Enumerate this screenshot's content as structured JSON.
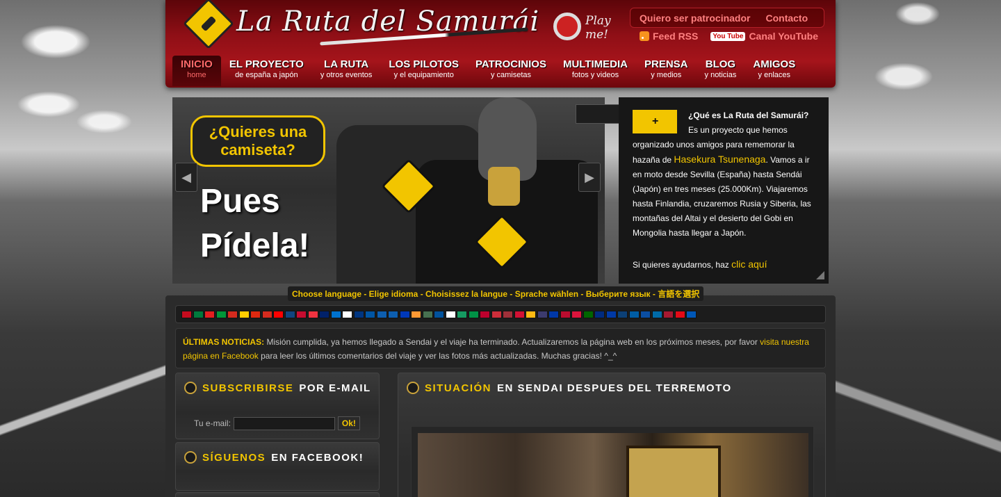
{
  "header": {
    "logo_text": "La Ruta del Samurái",
    "play_me": "Play me!",
    "top_links": [
      "Quiero ser patrocinador",
      "Contacto"
    ],
    "feed_rss": "Feed RSS",
    "youtube_badge": "You Tube",
    "canal_youtube": "Canal YouTube",
    "colors": {
      "header_red": "#8f0f16",
      "link_pink": "#ff8080",
      "accent_yellow": "#f2c500"
    }
  },
  "nav": [
    {
      "title": "INICIO",
      "sub": "home",
      "active": true
    },
    {
      "title": "EL PROYECTO",
      "sub": "de españa a japón"
    },
    {
      "title": "LA RUTA",
      "sub": "y otros eventos"
    },
    {
      "title": "LOS PILOTOS",
      "sub": "y el equipamiento"
    },
    {
      "title": "PATROCINIOS",
      "sub": "y camisetas"
    },
    {
      "title": "MULTIMEDIA",
      "sub": "fotos y videos"
    },
    {
      "title": "PRENSA",
      "sub": "y medios"
    },
    {
      "title": "BLOG",
      "sub": "y noticias"
    },
    {
      "title": "AMIGOS",
      "sub": "y enlaces"
    }
  ],
  "slider": {
    "bubble": "¿Quieres una camiseta?",
    "headline": "Pues Pídela!",
    "prev_icon": "chevron-left-icon",
    "next_icon": "chevron-right-icon"
  },
  "info": {
    "question": "¿Qué es La Ruta del Samurái?",
    "p1a": "Es un proyecto que hemos organizado unos amigos para rememorar la hazaña de",
    "link_name": "Hasekura Tsunenaga",
    "p1b": ". Vamos a ir en moto desde Sevilla (España) hasta Sendái (Japón) en tres meses (25.000Km). Viajaremos hasta Finlandia, cruzaremos Rusia y Siberia, las montañas del Altai y el desierto del Gobi en Mongolia hasta llegar a Japón.",
    "p2": "Si quieres ayudarnos, haz",
    "p2_link": "clic aquí"
  },
  "language_bar": "Choose language - Elige idioma - Choisissez la langue - Sprache wählen - Выберите язык - 言語を選択",
  "flags": [
    "#c60b1e",
    "#007a3d",
    "#e41e20",
    "#009639",
    "#d52b1e",
    "#ffcc00",
    "#de2910",
    "#d52b1e",
    "#ff0000",
    "#11457e",
    "#c60c30",
    "#ef3340",
    "#012169",
    "#0072ce",
    "#ffffff",
    "#003580",
    "#0055a4",
    "#0d5eaf",
    "#0d5eaf",
    "#0038b8",
    "#ff9933",
    "#477050",
    "#02529c",
    "#ffffff",
    "#169b62",
    "#009246",
    "#bc002d",
    "#cd2e3a",
    "#9e3039",
    "#d21034",
    "#fdb913",
    "#3c3b6e",
    "#0038a8",
    "#ba0c2f",
    "#dc143c",
    "#006600",
    "#002b7f",
    "#0039a6",
    "#0c4076",
    "#005da4",
    "#0b4ea2",
    "#006aa7",
    "#a51931",
    "#e30a17",
    "#0057b7"
  ],
  "news": {
    "label": "ÚLTIMAS NOTICIAS:",
    "text": "Misión cumplida, ya hemos llegado a Sendai y el viaje ha terminado. Actualizaremos la página web en los próximos meses, por favor",
    "link": "visita nuestra página en Facebook",
    "text2": "para leer los últimos comentarios del viaje y ver las fotos más actualizadas. Muchas gracias! ^_^"
  },
  "subscribe": {
    "title_hl": "SUBSCRIBIRSE",
    "title_rest": "POR E-MAIL",
    "label": "Tu e-mail:",
    "button": "Ok!"
  },
  "facebook_widget": {
    "title_hl": "SÍGUENOS",
    "title_rest": "EN FACEBOOK!"
  },
  "article": {
    "title_hl": "SITUACIÓN",
    "title_rest": "EN SENDAI DESPUES DEL TERREMOTO"
  }
}
